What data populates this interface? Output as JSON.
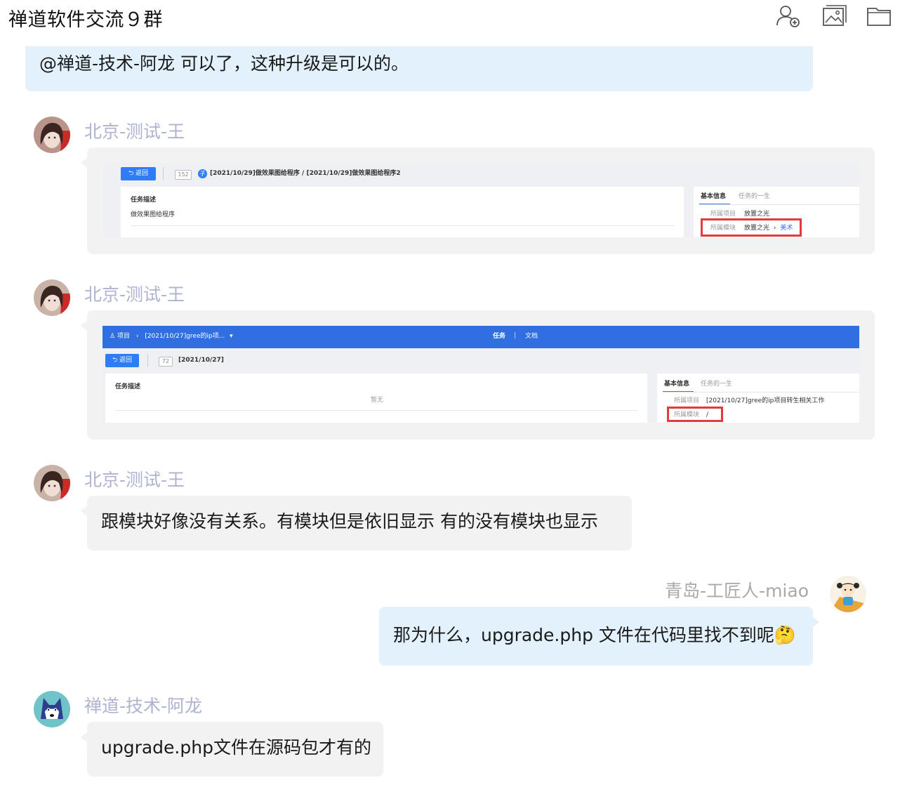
{
  "header": {
    "title": "禅道软件交流９群",
    "icons": [
      "add-member-icon",
      "image-icon",
      "folder-icon"
    ]
  },
  "colors": {
    "bubble_blue": "#e2f1fc",
    "bubble_gray": "#f2f2f2",
    "sender_name": "#aeb3cf",
    "highlight": "#e23b3b",
    "zentao_blue": "#2e7cf6"
  },
  "messages": [
    {
      "text": "@禅道-技术-阿龙 可以了，这种升级是可以的。"
    },
    {
      "sender": "北京-测试-王",
      "shot": {
        "back": "返回",
        "id": "152",
        "badge": "子",
        "breadcrumb": "[2021/10/29]做效果图给程序 / [2021/10/29]做效果图给程序2",
        "desc_title": "任务描述",
        "desc_text": "做效果图给程序",
        "tab1": "基本信息",
        "tab2": "任务的一生",
        "row1_label": "所属项目",
        "row1_value": "放置之光",
        "row2_label": "所属模块",
        "row2_value": "放置之光",
        "row2_arrow": "›",
        "row2_sub": "美术"
      }
    },
    {
      "sender": "北京-测试-王",
      "shot": {
        "project_label": "项目",
        "project_sep": "›",
        "project_name": "[2021/10/27]gree的ip项...",
        "project_caret": "▾",
        "nav_task": "任务",
        "nav_bar": "|",
        "nav_doc": "文档",
        "back": "返回",
        "id": "72",
        "title": "[2021/10/27]",
        "desc_title": "任务描述",
        "desc_text": "暂无",
        "tab1": "基本信息",
        "tab2": "任务的一生",
        "row1_label": "所属项目",
        "row1_value": "[2021/10/27]gree的ip项目转生相关工作",
        "row2_label": "所属模块",
        "row2_value": "/"
      }
    },
    {
      "sender": "北京-测试-王",
      "text": "跟模块好像没有关系。有模块但是依旧显示 有的没有模块也显示"
    },
    {
      "sender": "青岛-工匠人-miao",
      "text": "那为什么，upgrade.php 文件在代码里找不到呢",
      "emoji": "🤔"
    },
    {
      "sender": "禅道-技术-阿龙",
      "text": "upgrade.php文件在源码包才有的"
    }
  ]
}
